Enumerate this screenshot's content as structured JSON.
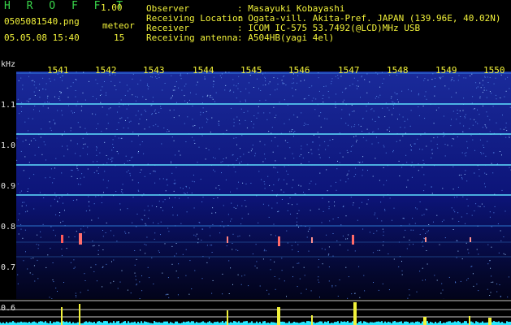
{
  "app": {
    "name": "H R O F F T",
    "version": "1.00"
  },
  "file": "0505081540.png",
  "datetime": "05.05.08 15:40",
  "meteor": {
    "label": "meteor",
    "count": "15"
  },
  "info": [
    {
      "label": "Observer",
      "value": ": Masayuki Kobayashi"
    },
    {
      "label": "Receiving Location",
      "value": ": Ogata-vill. Akita-Pref. JAPAN (139.96E, 40.02N)"
    },
    {
      "label": "Receiver",
      "value": ": ICOM IC-575 53.7492(@LCD)MHz USB"
    },
    {
      "label": "Receiving antenna",
      "value": ": A504HB(yagi 4el)"
    }
  ],
  "time_axis": [
    "1541",
    "1542",
    "1543",
    "1544",
    "1545",
    "1546",
    "1547",
    "1548",
    "1549",
    "1550"
  ],
  "freq_axis": {
    "unit": "kHz",
    "ticks": [
      "1.1",
      "1.0",
      "0.9",
      "0.8",
      "0.7",
      "0.6"
    ]
  },
  "colors": {
    "header_green": "#39d64a",
    "header_yellow": "#f2f23a",
    "spectrum_bg": "#0a0a5a",
    "trace_cyan": "#28e8ff"
  }
}
